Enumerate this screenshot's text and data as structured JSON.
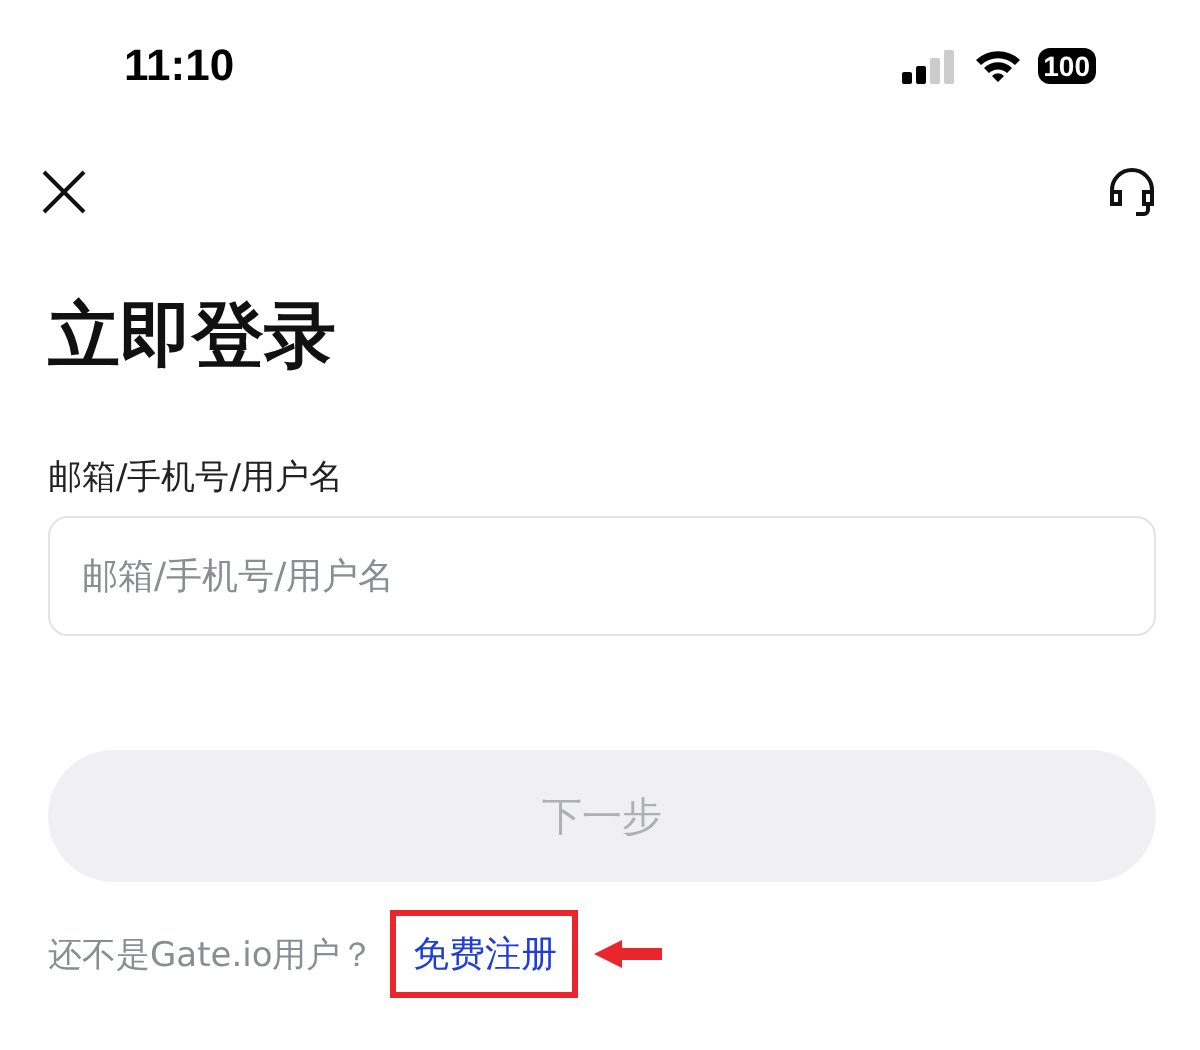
{
  "status_bar": {
    "time": "11:10",
    "battery": "100"
  },
  "title": "立即登录",
  "field": {
    "label": "邮箱/手机号/用户名",
    "placeholder": "邮箱/手机号/用户名"
  },
  "next_button": {
    "label": "下一步",
    "disabled": true
  },
  "signup": {
    "prompt": "还不是Gate.io用户？",
    "link": "免费注册",
    "highlighted": true
  }
}
